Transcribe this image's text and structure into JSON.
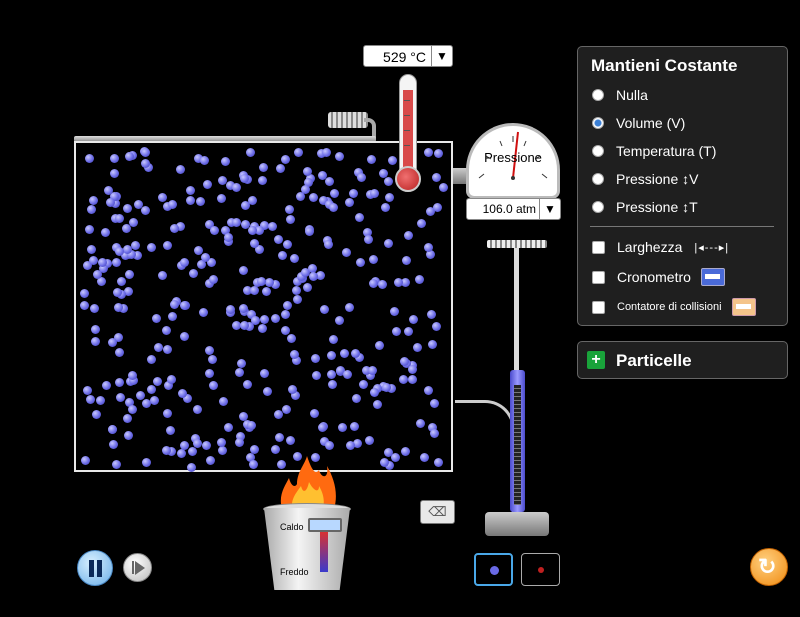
{
  "thermometer": {
    "value": "529 °C",
    "dropdown_icon": "triangle-down"
  },
  "gauge": {
    "label": "Pressione",
    "value": "106.0 atm",
    "dropdown_icon": "triangle-down"
  },
  "panel": {
    "title": "Mantieni Costante",
    "options": [
      {
        "label": "Nulla",
        "selected": false
      },
      {
        "label": "Volume (V)",
        "selected": true
      },
      {
        "label": "Temperatura (T)",
        "selected": false
      },
      {
        "label": "Pressione ↕V",
        "selected": false
      },
      {
        "label": "Pressione ↕T",
        "selected": false
      }
    ],
    "checks": [
      {
        "label": "Larghezza",
        "checked": false
      },
      {
        "label": "Cronometro",
        "checked": false
      },
      {
        "label": "Contatore di collisioni",
        "checked": false
      }
    ]
  },
  "particles_panel": {
    "title": "Particelle",
    "icon": "plus-icon"
  },
  "bucket": {
    "hot_label": "Caldo",
    "cold_label": "Freddo"
  },
  "colors": {
    "particle": "#6a6ae6",
    "panel_bg": "#1f1f1f",
    "accent": "#4aa8e8",
    "reset": "#f08a10"
  }
}
